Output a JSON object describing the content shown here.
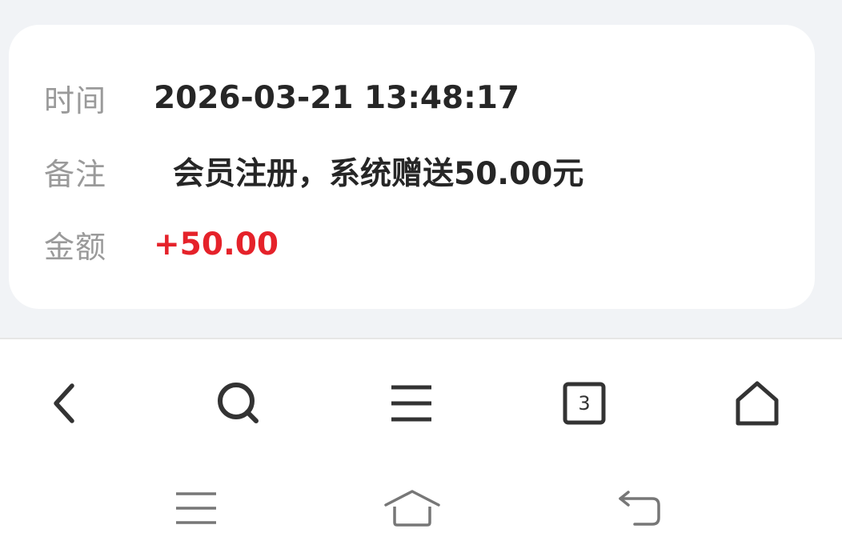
{
  "record": {
    "time_label": "时间",
    "time_value": "2026-03-21 13:48:17",
    "remark_label": "备注",
    "remark_value": "会员注册，系统赠送50.00元",
    "amount_label": "金额",
    "amount_value": "+50.00",
    "amount_color": "#e5222a"
  },
  "browser_toolbar": {
    "back_icon": "chevron-left-icon",
    "search_icon": "search-icon",
    "menu_icon": "hamburger-menu-icon",
    "tabs_icon": "tabs-icon",
    "tabs_count": "3",
    "home_icon": "home-icon"
  },
  "system_nav": {
    "menu_icon": "menu-icon",
    "home_icon": "home-icon",
    "back_icon": "back-icon"
  }
}
